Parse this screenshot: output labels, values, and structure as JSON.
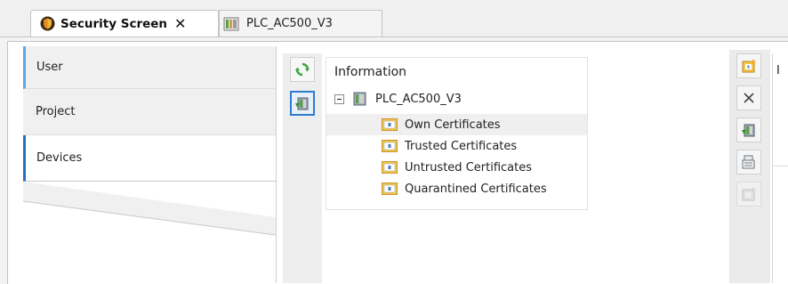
{
  "tabs": [
    {
      "label": "Security Screen",
      "active": true,
      "closable": true
    },
    {
      "label": "PLC_AC500_V3",
      "active": false
    }
  ],
  "sidebar": {
    "items": [
      {
        "label": "User"
      },
      {
        "label": "Project"
      },
      {
        "label": "Devices",
        "selected": true
      }
    ]
  },
  "toolbar": {
    "refresh_icon": "refresh-icon",
    "device_icon": "device-certificate-icon"
  },
  "tree": {
    "header": "Information",
    "root": {
      "label": "PLC_AC500_V3",
      "expanded": true
    },
    "children": [
      {
        "label": "Own Certificates",
        "selected": true
      },
      {
        "label": "Trusted Certificates"
      },
      {
        "label": "Untrusted Certificates"
      },
      {
        "label": "Quarantined Certificates"
      }
    ]
  },
  "right_toolbar": {
    "buttons": [
      "create-certificate-icon",
      "delete-icon",
      "install-certificate-icon",
      "export-certificate-icon",
      "renew-certificate-icon"
    ]
  },
  "right_panel": {
    "header": "I"
  },
  "colors": {
    "accent_blue": "#1f72c6",
    "light_blue": "#5da7e6",
    "green": "#3aa63a",
    "folder_yellow": "#f2c64e"
  }
}
